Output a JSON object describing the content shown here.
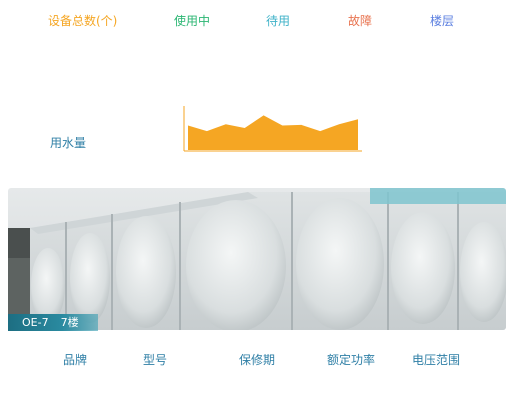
{
  "header": {
    "device_total": "设备总数(个)",
    "in_use": "使用中",
    "standby": "待用",
    "fault": "故障",
    "floor": "楼层"
  },
  "colors": {
    "device_total": "#f5a623",
    "in_use": "#2bb673",
    "standby": "#3fb2c8",
    "fault": "#e8734f",
    "floor": "#5b7fe0",
    "chart_fill": "#f5a623",
    "label_blue": "#2f7fa6",
    "tag_bg": "#1d6e82"
  },
  "usage": {
    "label": "用水量"
  },
  "chart_data": {
    "type": "area",
    "title": "",
    "xlabel": "",
    "ylabel": "",
    "x": [
      1,
      2,
      3,
      4,
      5,
      6,
      7,
      8,
      9,
      10
    ],
    "values": [
      0.78,
      0.6,
      0.82,
      0.7,
      1.1,
      0.78,
      0.8,
      0.6,
      0.82,
      0.98
    ],
    "ylim": [
      0,
      1.4
    ],
    "grid": false,
    "axes": [
      "left",
      "bottom"
    ]
  },
  "tank": {
    "id": "OE-7",
    "floor": "7楼"
  },
  "footer": {
    "brand": "品牌",
    "model": "型号",
    "warranty": "保修期",
    "rated_power": "额定功率",
    "voltage_range": "电压范围"
  }
}
